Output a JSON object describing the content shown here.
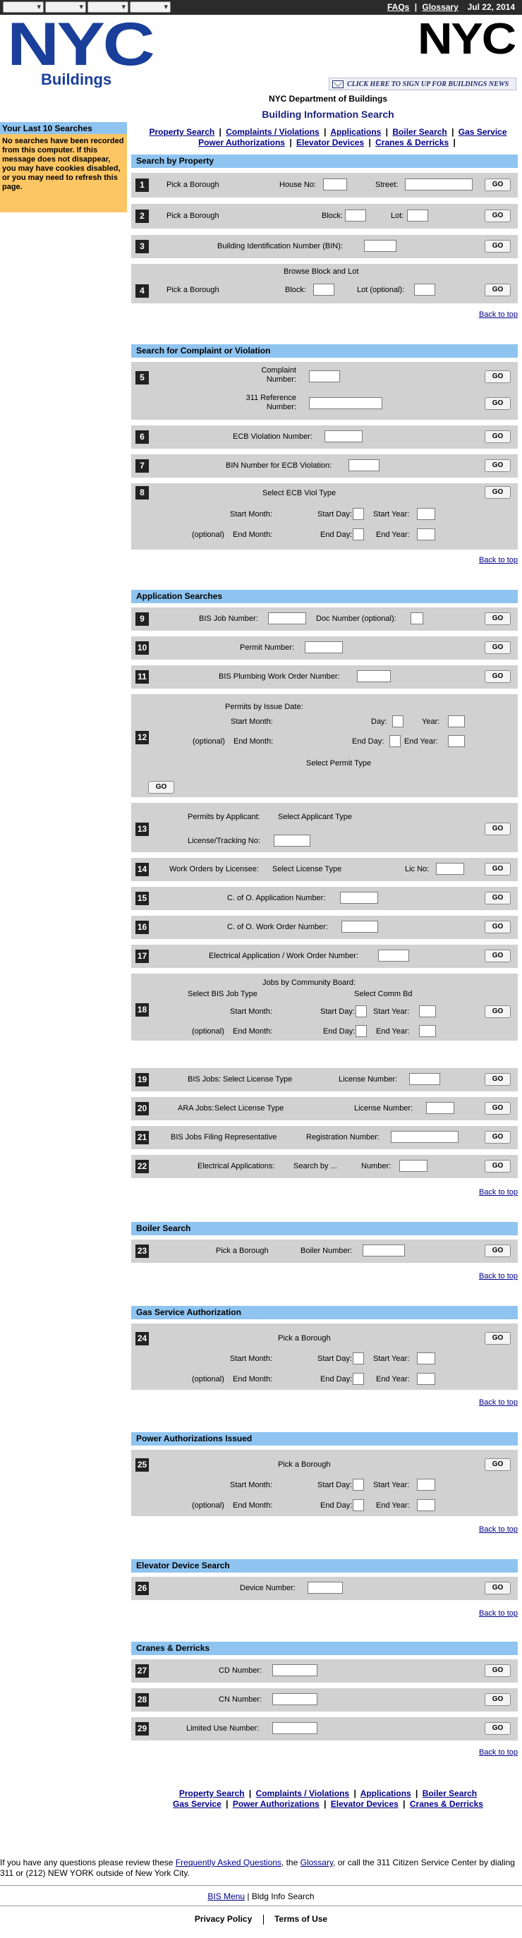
{
  "topbar": {
    "faqs": "FAQs",
    "sep": "|",
    "glossary": "Glossary",
    "date": "Jul 22, 2014"
  },
  "logo": {
    "left_text": "NYC",
    "left_sub": "Buildings",
    "right_text": "NYC"
  },
  "signup_text": "CLICK HERE TO SIGN UP FOR BUILDINGS NEWS",
  "dept": "NYC Department of Buildings",
  "title": "Building Information Search",
  "sidebar": {
    "header": "Your Last 10 Searches",
    "message": "No searches have been recorded from this computer. If this message does not disappear, you may have cookies disabled, or you may need to refresh this page."
  },
  "nav": {
    "property": "Property Search",
    "complaints": "Complaints / Violations",
    "applications": "Applications",
    "boiler": "Boiler Search",
    "gas": "Gas Service",
    "power": "Power Authorizations",
    "elevator": "Elevator Devices",
    "cranes": "Cranes & Derricks",
    "sep": "|"
  },
  "go": "GO",
  "back_to_top": "Back to top",
  "sections": {
    "property": "Search by Property",
    "complaint": "Search for Complaint or Violation",
    "application": "Application Searches",
    "boiler": "Boiler Search",
    "gas": "Gas Service Authorization",
    "power": "Power Authorizations Issued",
    "elevator": "Elevator Device Search",
    "cranes": "Cranes & Derricks"
  },
  "rows": {
    "r1": {
      "num": "1",
      "borough": "Pick a Borough",
      "house": "House No:",
      "street": "Street:"
    },
    "r2": {
      "num": "2",
      "borough": "Pick a Borough",
      "block": "Block:",
      "lot": "Lot:"
    },
    "r3": {
      "num": "3",
      "bin": "Building Identification Number (BIN):"
    },
    "r4": {
      "num": "4",
      "browse": "Browse Block and Lot",
      "borough": "Pick a Borough",
      "block": "Block:",
      "lot": "Lot (optional):"
    },
    "r5": {
      "num": "5",
      "complaint": "Complaint Number:",
      "ref311": "311 Reference Number:"
    },
    "r6": {
      "num": "6",
      "ecb": "ECB Violation Number:"
    },
    "r7": {
      "num": "7",
      "bin_ecb": "BIN Number for ECB Violation:"
    },
    "r8": {
      "num": "8",
      "select": "Select ECB Viol Type",
      "start_month": "Start Month:",
      "start_day": "Start Day:",
      "start_year": "Start Year:",
      "opt": "(optional)",
      "end_month": "End Month:",
      "end_day": "End Day:",
      "end_year": "End Year:"
    },
    "r9": {
      "num": "9",
      "job": "BIS Job Number:",
      "doc": "Doc Number (optional):"
    },
    "r10": {
      "num": "10",
      "permit": "Permit Number:"
    },
    "r11": {
      "num": "11",
      "plumbing": "BIS Plumbing Work Order Number:"
    },
    "r12": {
      "num": "12",
      "heading": "Permits by Issue Date:",
      "start_month": "Start Month:",
      "day": "Day:",
      "year": "Year:",
      "opt": "(optional)",
      "end_month": "End Month:",
      "end_day": "End Day:",
      "end_year": "End Year:",
      "select": "Select Permit Type"
    },
    "r13": {
      "num": "13",
      "heading": "Permits by Applicant:",
      "select": "Select Applicant Type",
      "license": "License/Tracking No:"
    },
    "r14": {
      "num": "14",
      "heading": "Work Orders by Licensee:",
      "select": "Select License Type",
      "lic": "Lic No:"
    },
    "r15": {
      "num": "15",
      "label": "C. of O. Application Number:"
    },
    "r16": {
      "num": "16",
      "label": "C. of O. Work Order Number:"
    },
    "r17": {
      "num": "17",
      "label": "Electrical Application / Work Order Number:"
    },
    "r18": {
      "num": "18",
      "heading": "Jobs by Community Board:",
      "select_job": "Select BIS Job Type",
      "select_comm": "Select Comm Bd",
      "start_month": "Start Month:",
      "start_day": "Start Day:",
      "start_year": "Start Year:",
      "opt": "(optional)",
      "end_month": "End Month:",
      "end_day": "End Day:",
      "end_year": "End Year:"
    },
    "r19": {
      "num": "19",
      "heading": "BIS Jobs:",
      "select": "Select License Type",
      "license": "License Number:"
    },
    "r20": {
      "num": "20",
      "heading": "ARA Jobs:",
      "select": "Select License Type",
      "license": "License Number:"
    },
    "r21": {
      "num": "21",
      "heading": "BIS Jobs Filing Representative",
      "reg": "Registration Number:"
    },
    "r22": {
      "num": "22",
      "heading": "Electrical Applications:",
      "search_by": "Search by ...",
      "number": "Number:"
    },
    "r23": {
      "num": "23",
      "borough": "Pick a Borough",
      "boiler": "Boiler Number:"
    },
    "r24": {
      "num": "24",
      "borough": "Pick a Borough",
      "start_month": "Start Month:",
      "start_day": "Start Day:",
      "start_year": "Start Year:",
      "opt": "(optional)",
      "end_month": "End Month:",
      "end_day": "End Day:",
      "end_year": "End Year:"
    },
    "r25": {
      "num": "25",
      "borough": "Pick a Borough",
      "start_month": "Start Month:",
      "start_day": "Start Day:",
      "start_year": "Start Year:",
      "opt": "(optional)",
      "end_month": "End Month:",
      "end_day": "End Day:",
      "end_year": "End Year:"
    },
    "r26": {
      "num": "26",
      "device": "Device Number:"
    },
    "r27": {
      "num": "27",
      "cd": "CD Number:"
    },
    "r28": {
      "num": "28",
      "cn": "CN Number:"
    },
    "r29": {
      "num": "29",
      "limited": "Limited Use Number:"
    }
  },
  "footer": {
    "question_pre": "If you have any questions please review these ",
    "faq_link": "Frequently Asked Questions",
    "question_mid": ", the ",
    "glossary_link": "Glossary",
    "question_post": ", or call the 311 Citizen Service Center by dialing 311 or (212) NEW YORK outside of New York City.",
    "bis_menu": "BIS Menu",
    "bldg_info": " | Bldg Info Search",
    "privacy": "Privacy Policy",
    "terms": "Terms of Use"
  }
}
